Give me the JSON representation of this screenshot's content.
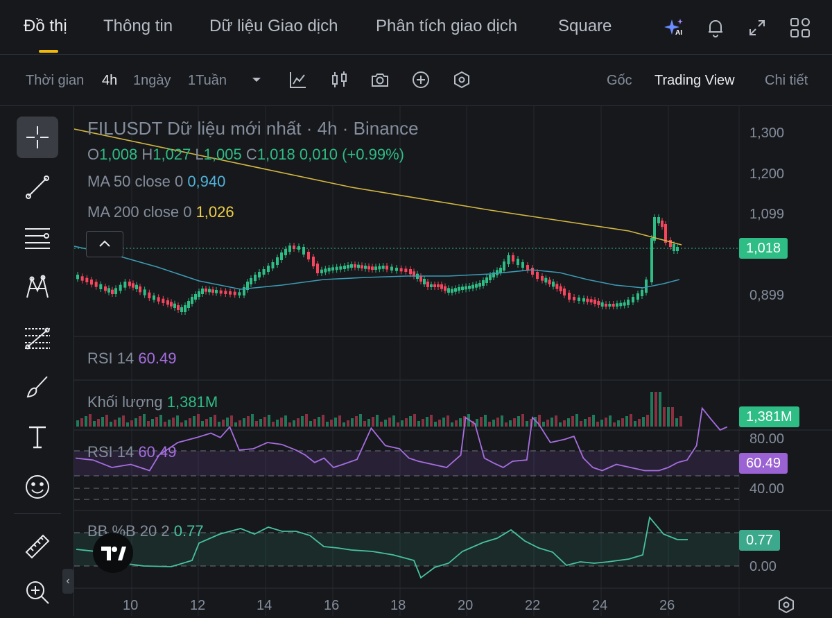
{
  "top_tabs": [
    {
      "label": "Đồ thị"
    },
    {
      "label": "Thông tin"
    },
    {
      "label": "Dữ liệu Giao dịch"
    },
    {
      "label": "Phân tích giao dịch"
    },
    {
      "label": "Square"
    }
  ],
  "top_icons": [
    "ai-sparkle-icon",
    "bell-icon",
    "expand-icon",
    "grid-apps-icon"
  ],
  "ai_badge": "AI",
  "toolbar": {
    "time_label": "Thời gian",
    "intervals": [
      "4h",
      "1ngày",
      "1Tuần"
    ],
    "view_options": [
      "Gốc",
      "Trading View",
      "Chi tiết"
    ]
  },
  "chart": {
    "title": "FILUSDT Dữ liệu mới nhất · 4h · Binance",
    "ohlc": {
      "o_label": "O",
      "o": "1,008",
      "h_label": "H",
      "h": "1,027",
      "l_label": "L",
      "l": "1,005",
      "c_label": "C",
      "c": "1,018",
      "change": "0,010 (+0.99%)"
    },
    "ma50": {
      "label": "MA 50 close 0",
      "value": "0,940"
    },
    "ma200": {
      "label": "MA 200 close 0",
      "value": "1,026"
    },
    "rsi_header": {
      "label": "RSI 14",
      "value": "60.49"
    },
    "volume": {
      "label": "Khối lượng",
      "value": "1,381M"
    },
    "rsi": {
      "label": "RSI 14",
      "value": "60.49"
    },
    "bb": {
      "label": "BB %B 20 2",
      "value": "0.77"
    },
    "price_axis": [
      "1,300",
      "1,200",
      "1,099",
      "0,899"
    ],
    "current_price": "1,018",
    "volume_tag": "1,381M",
    "rsi_axis": [
      "80.00",
      "40.00"
    ],
    "rsi_tag": "60.49",
    "bb_axis": [
      "0.00"
    ],
    "bb_tag": "0.77",
    "x_axis": [
      "10",
      "12",
      "14",
      "16",
      "18",
      "20",
      "22",
      "24",
      "26"
    ],
    "colors": {
      "up": "#2ebd85",
      "down": "#f6465d",
      "ma50": "#3b9bb5",
      "ma200": "#d4b842",
      "rsi": "#a66ee0",
      "bb": "#47c2a0"
    }
  }
}
